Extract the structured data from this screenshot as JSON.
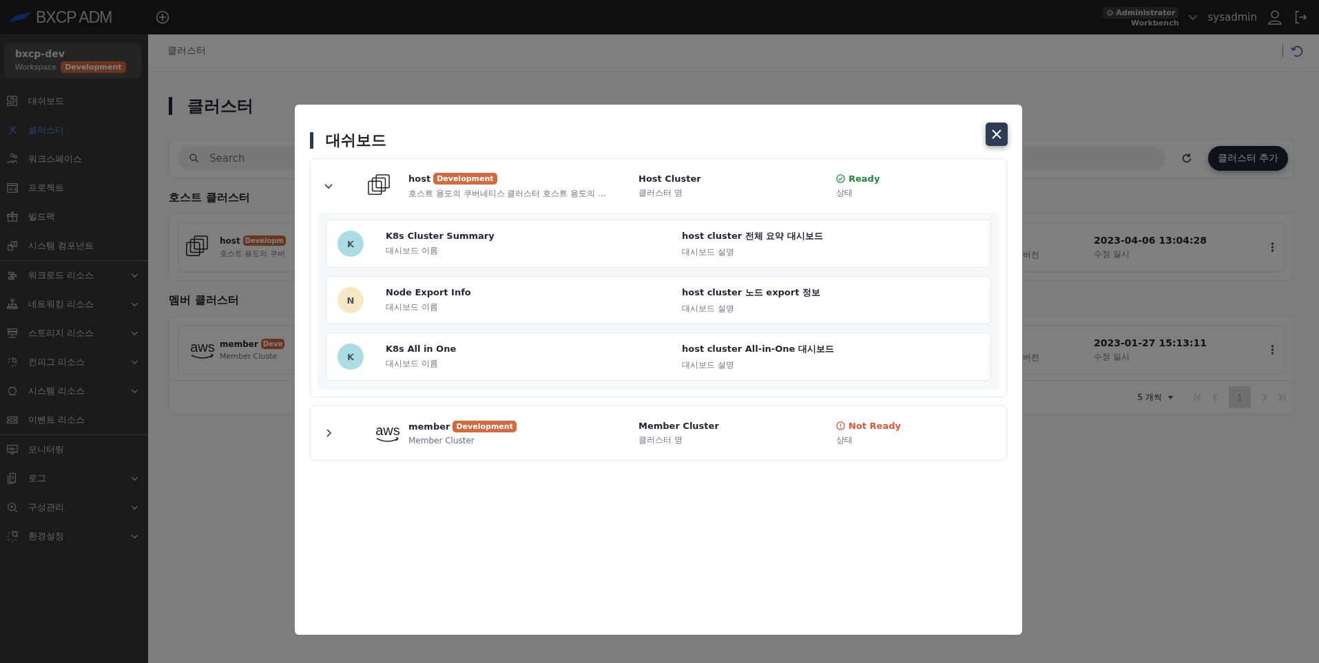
{
  "header": {
    "brand": "BXCP ADM",
    "role": "Administrator",
    "workbench": "Workbench",
    "user": "sysadmin"
  },
  "workspace": {
    "name": "bxcp-dev",
    "label": "Workspace",
    "badge": "Development"
  },
  "sidebar": {
    "groups": [
      {
        "items": [
          {
            "label": "대쉬보드",
            "selected": false,
            "expandable": false
          },
          {
            "label": "클러스터",
            "selected": true,
            "expandable": false
          },
          {
            "label": "워크스페이스",
            "selected": false,
            "expandable": false
          },
          {
            "label": "프로젝트",
            "selected": false,
            "expandable": false
          },
          {
            "label": "빌드팩",
            "selected": false,
            "expandable": false
          },
          {
            "label": "시스템 컴포넌트",
            "selected": false,
            "expandable": false
          }
        ]
      },
      {
        "items": [
          {
            "label": "워크로드 리소스",
            "selected": false,
            "expandable": true
          },
          {
            "label": "네트워킹 리소스",
            "selected": false,
            "expandable": true
          },
          {
            "label": "스토리지 리소스",
            "selected": false,
            "expandable": true
          },
          {
            "label": "컨피그 리소스",
            "selected": false,
            "expandable": true
          },
          {
            "label": "시스템 리소스",
            "selected": false,
            "expandable": true
          },
          {
            "label": "이벤트 리소스",
            "selected": false,
            "expandable": false
          }
        ]
      },
      {
        "items": [
          {
            "label": "모니터링",
            "selected": false,
            "expandable": false
          },
          {
            "label": "로그",
            "selected": false,
            "expandable": true
          },
          {
            "label": "구성관리",
            "selected": false,
            "expandable": true
          },
          {
            "label": "환경설정",
            "selected": false,
            "expandable": true
          }
        ]
      }
    ]
  },
  "page": {
    "breadcrumb": "클러스터",
    "title": "클러스터",
    "search": {
      "placeholder": "Search"
    },
    "add_button": "클러스터 추가",
    "sections": [
      {
        "heading": "호스트 클러스터",
        "cards": [
          {
            "kind": "host",
            "name": "host",
            "badge": "Developm",
            "description": "호스트 용도의 쿠버",
            "version_label": "버전",
            "date": "2023-04-06 13:04:28",
            "date_label": "수정 일시"
          }
        ]
      },
      {
        "heading": "멤버 클러스터",
        "cards": [
          {
            "kind": "aws",
            "logo_text": "aws",
            "name": "member",
            "badge": "Deve",
            "description": "Member Cluste",
            "version_label": "버전",
            "date": "2023-01-27 15:13:11",
            "date_label": "수정 일시"
          }
        ],
        "pagination": {
          "page_size": "5 개씩",
          "pages": [
            {
              "label": "1",
              "selected": true
            }
          ]
        }
      }
    ]
  },
  "modal": {
    "title": "대쉬보드",
    "clusters": [
      {
        "kind": "host",
        "name": "host",
        "badge": "Development",
        "description": "호스트 용도의 쿠버네티스 클러스터 호스트 용도의 …",
        "type": "Host Cluster",
        "type_label": "클러스터 명",
        "status": "Ready",
        "status_label": "상태",
        "ready": true,
        "expanded": true,
        "dashboards": [
          {
            "initial": "K",
            "color": "#abdde5",
            "name": "K8s Cluster Summary",
            "name_label": "대시보드 이름",
            "description": "host cluster 전체 요약 대시보드",
            "description_label": "대시보드 설명"
          },
          {
            "initial": "N",
            "color": "#f5e8c2",
            "name": "Node Export Info",
            "name_label": "대시보드 이름",
            "description": "host cluster 노드 export 정보",
            "description_label": "대시보드 설명"
          },
          {
            "initial": "K",
            "color": "#abdde5",
            "name": "K8s All in One",
            "name_label": "대시보드 이름",
            "description": "host cluster All-in-One 대시보드",
            "description_label": "대시보드 설명"
          }
        ]
      },
      {
        "kind": "aws",
        "logo_text": "aws",
        "name": "member",
        "badge": "Development",
        "description": "Member Cluster",
        "type": "Member Cluster",
        "type_label": "클러스터 명",
        "status": "Not Ready",
        "status_label": "상태",
        "ready": false,
        "expanded": false
      }
    ]
  }
}
